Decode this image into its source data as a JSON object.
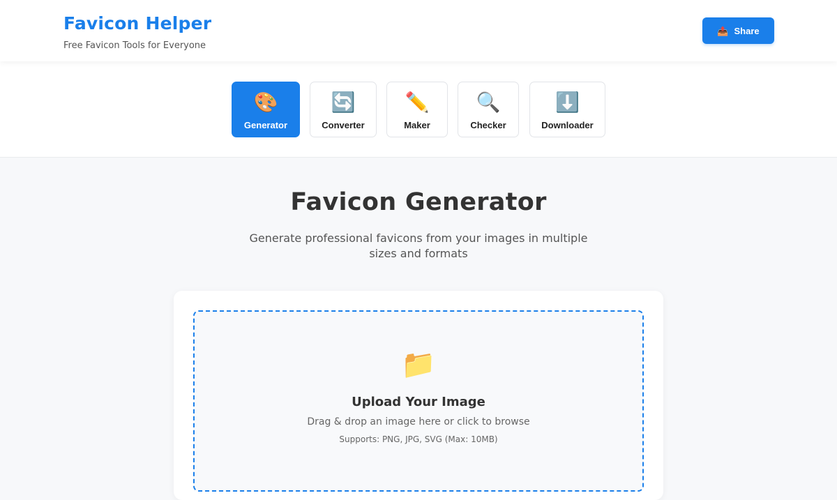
{
  "header": {
    "title": "Favicon Helper",
    "subtitle": "Free Favicon Tools for Everyone",
    "share_icon": "📤",
    "share_label": "Share"
  },
  "tabs": [
    {
      "label": "Generator",
      "icon": "🎨",
      "icon_name": "palette-icon",
      "active": true
    },
    {
      "label": "Converter",
      "icon": "🔄",
      "icon_name": "arrows-cycle-icon",
      "active": false
    },
    {
      "label": "Maker",
      "icon": "✏️",
      "icon_name": "pencil-icon",
      "active": false
    },
    {
      "label": "Checker",
      "icon": "🔍",
      "icon_name": "magnifier-icon",
      "active": false
    },
    {
      "label": "Downloader",
      "icon": "⬇️",
      "icon_name": "download-arrow-icon",
      "active": false
    }
  ],
  "main": {
    "title": "Favicon Generator",
    "description": "Generate professional favicons from your images in multiple sizes and formats"
  },
  "upload": {
    "icon": "📁",
    "title": "Upload Your Image",
    "description": "Drag & drop an image here or click to browse",
    "support": "Supports: PNG, JPG, SVG (Max: 10MB)"
  },
  "colors": {
    "accent": "#1a7fea",
    "background": "#f7f8fa",
    "surface": "#ffffff"
  }
}
